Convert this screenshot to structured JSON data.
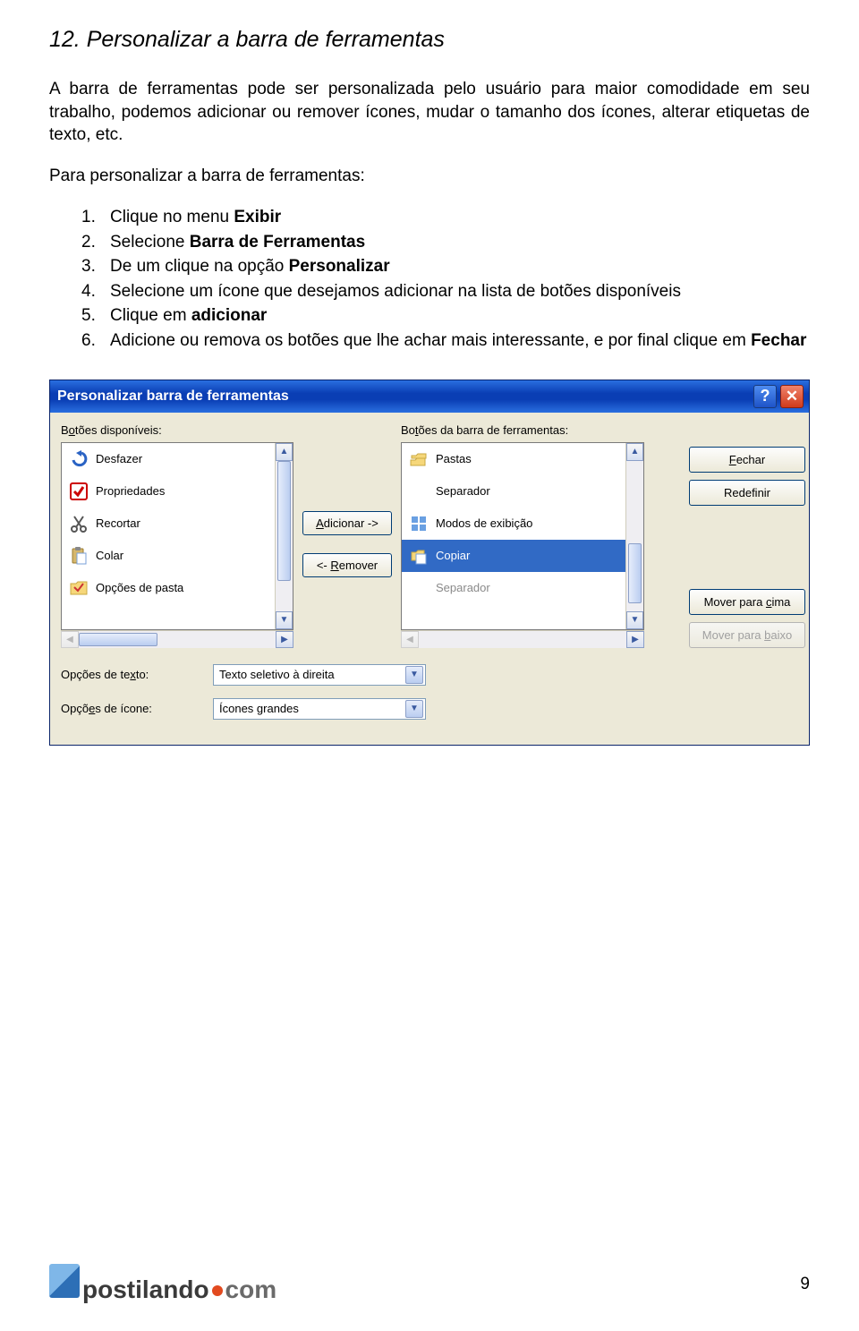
{
  "section": {
    "number": "12.",
    "title": "Personalizar a barra de ferramentas"
  },
  "intro": "A barra de ferramentas pode ser personalizada pelo usuário para maior comodidade em seu trabalho, podemos adicionar ou remover ícones, mudar o tamanho dos ícones, alterar etiquetas de texto, etc.",
  "sub": "Para personalizar a barra de ferramentas:",
  "steps": [
    {
      "pre": "Clique no menu ",
      "bold": "Exibir",
      "post": ""
    },
    {
      "pre": "Selecione ",
      "bold": "Barra de Ferramentas",
      "post": ""
    },
    {
      "pre": "De um clique na opção ",
      "bold": "Personalizar",
      "post": ""
    },
    {
      "pre": "Selecione um ícone que desejamos adicionar na lista de botões disponíveis",
      "bold": "",
      "post": ""
    },
    {
      "pre": "Clique em ",
      "bold": "adicionar",
      "post": ""
    },
    {
      "pre": "Adicione ou remova os botões que lhe achar mais interessante, e por final clique em ",
      "bold": "Fechar",
      "post": ""
    }
  ],
  "dialog": {
    "title": "Personalizar barra de ferramentas",
    "help": "?",
    "close": "✕",
    "leftLabel_pre": "B",
    "leftLabel_u": "o",
    "leftLabel_post": "tões disponíveis:",
    "rightLabel_pre": "Bo",
    "rightLabel_u": "t",
    "rightLabel_post": "ões da barra de ferramentas:",
    "leftItems": [
      {
        "name": "Desfazer",
        "icon": "undo"
      },
      {
        "name": "Propriedades",
        "icon": "check"
      },
      {
        "name": "Recortar",
        "icon": "cut"
      },
      {
        "name": "Colar",
        "icon": "paste"
      },
      {
        "name": "Opções de pasta",
        "icon": "folderopt"
      }
    ],
    "rightItems": [
      {
        "name": "Pastas",
        "icon": "folders",
        "state": ""
      },
      {
        "name": "Separador",
        "icon": "sep",
        "state": ""
      },
      {
        "name": "Modos de exibição",
        "icon": "modes",
        "state": ""
      },
      {
        "name": "Copiar",
        "icon": "copy",
        "state": "sel"
      },
      {
        "name": "Separador",
        "icon": "sep",
        "state": "disabled"
      }
    ],
    "addBtn_u": "A",
    "addBtn_post": "dicionar ->",
    "removeBtn_pre": "<- ",
    "removeBtn_u": "R",
    "removeBtn_post": "emover",
    "closeBtn_u": "F",
    "closeBtn_post": "echar",
    "resetBtn": "Redefinir",
    "moveUpBtn_pre": "Mover para ",
    "moveUpBtn_u": "c",
    "moveUpBtn_post": "ima",
    "moveDownBtn_pre": "Mover para ",
    "moveDownBtn_u": "b",
    "moveDownBtn_post": "aixo",
    "optText_label_pre": "Opções de te",
    "optText_label_u": "x",
    "optText_label_post": "to:",
    "optText_value": "Texto seletivo à direita",
    "optIcon_label_pre": "Opçõ",
    "optIcon_label_u": "e",
    "optIcon_label_post": "s de ícone:",
    "optIcon_value": "Ícones grandes"
  },
  "footer": {
    "brand1": "postilando",
    "brand2": "com",
    "page": "9"
  }
}
